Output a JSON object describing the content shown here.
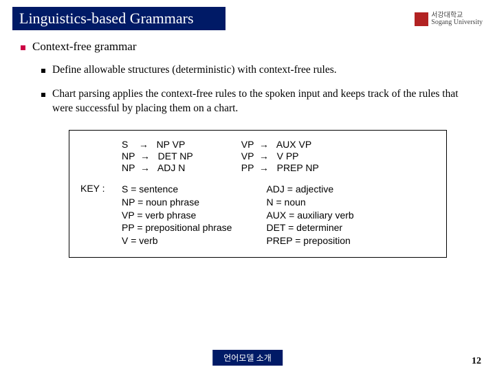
{
  "title": "Linguistics-based Grammars",
  "logo_text": "서강대학교\nSogang University",
  "h1": "Context-free grammar",
  "bullets": [
    "Define allowable structures (deterministic) with context-free rules.",
    "Chart parsing applies the context-free rules to the spoken input and keeps track of the rules that were successful by placing them on a chart."
  ],
  "grammar_left": [
    "S    →   NP VP",
    "NP  →   DET NP",
    "NP  →   ADJ N"
  ],
  "grammar_right": [
    "VP  →   AUX VP",
    "VP  →   V PP",
    "PP  →   PREP NP"
  ],
  "key_label": "KEY :",
  "key_left": [
    "S = sentence",
    "NP = noun phrase",
    "VP = verb phrase",
    "PP = prepositional phrase",
    "V = verb"
  ],
  "key_right": [
    "ADJ = adjective",
    "N = noun",
    "AUX = auxiliary verb",
    "DET = determiner",
    "PREP = preposition"
  ],
  "footer": "언어모델 소개",
  "page": "12"
}
